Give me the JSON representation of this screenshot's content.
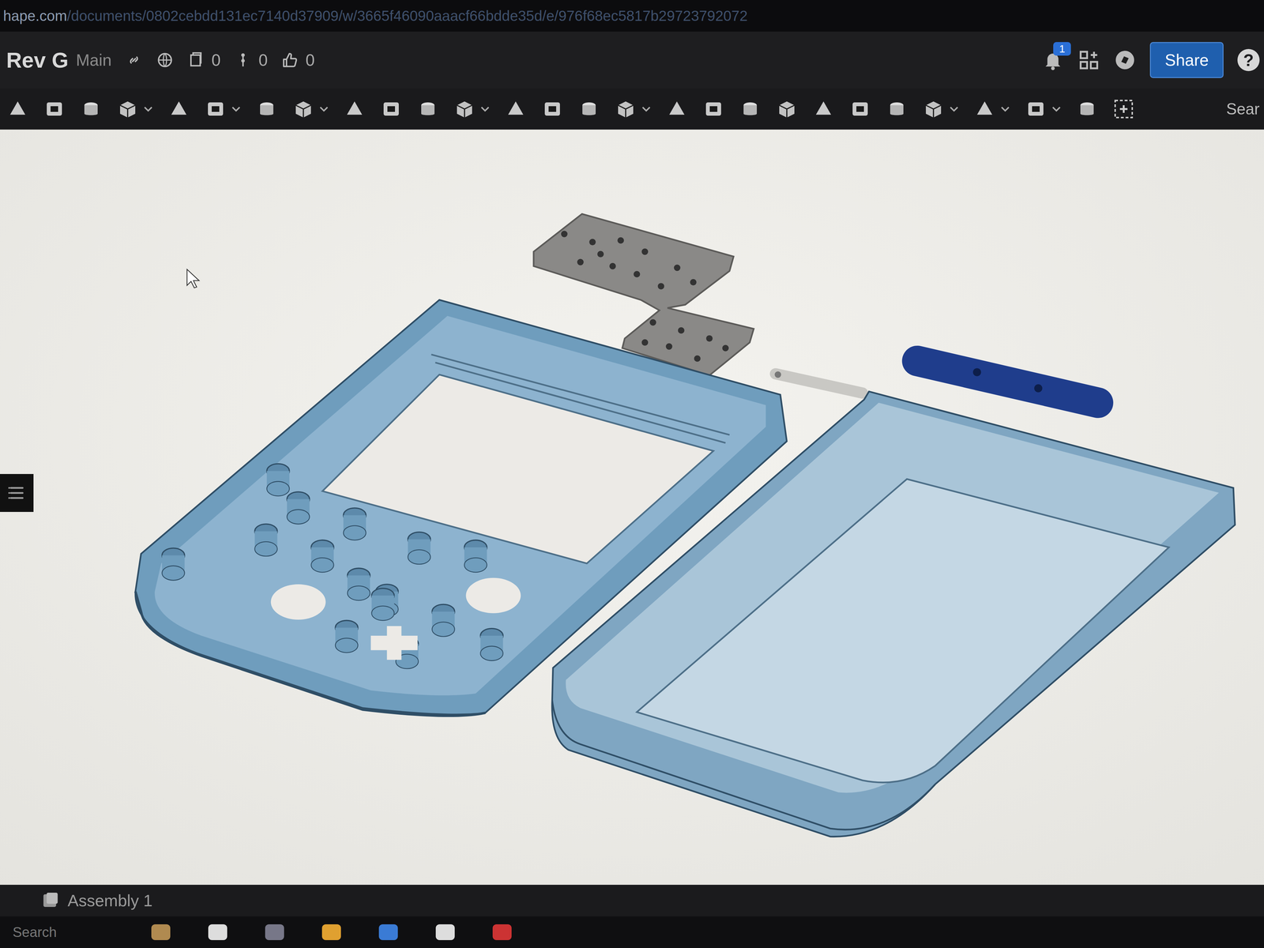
{
  "address_bar": {
    "host": "hape.com",
    "path": "/documents/0802cebdd131ec7140d37909/w/3665f46090aaacf66bdde35d/e/976f68ec5817b29723792072"
  },
  "document": {
    "title": "Rev G",
    "branch": "Main",
    "counts": [
      "0",
      "0",
      "0"
    ]
  },
  "notifications": {
    "badge": "1"
  },
  "share_button": "Share",
  "help": "?",
  "toolbar": {
    "search": "Sear"
  },
  "tabs": [
    {
      "label": "Assembly 1",
      "selected": true
    }
  ],
  "taskbar": {
    "search": "Search"
  }
}
